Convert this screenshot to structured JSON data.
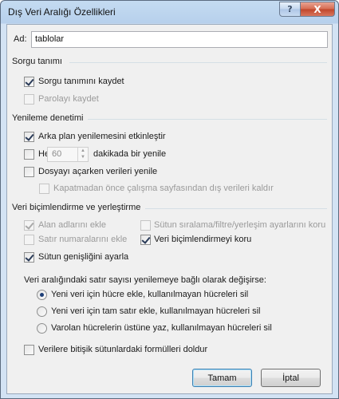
{
  "window": {
    "title": "Dış Veri Aralığı Özellikleri",
    "help_glyph": "?",
    "close_glyph": "X"
  },
  "name": {
    "label": "Ad:",
    "value": "tablolar"
  },
  "query": {
    "group_title": "Sorgu tanımı",
    "save_query": {
      "label": "Sorgu tanımını kaydet",
      "checked": true
    },
    "save_password": {
      "label": "Parolayı kaydet",
      "checked": false,
      "enabled": false
    }
  },
  "refresh": {
    "group_title": "Yenileme denetimi",
    "background_refresh": {
      "label": "Arka plan yenilemesini etkinleştir",
      "checked": true
    },
    "every": {
      "label": "Her",
      "value": "60",
      "suffix": "dakikada bir yenile",
      "checked": false
    },
    "on_open": {
      "label": "Dosyayı açarken verileri yenile",
      "checked": false
    },
    "remove_before_close": {
      "label": "Kapatmadan önce çalışma sayfasından dış verileri kaldır",
      "checked": false,
      "enabled": false
    }
  },
  "formatting": {
    "group_title": "Veri biçimlendirme ve yerleştirme",
    "field_names": {
      "label": "Alan adlarını ekle",
      "checked": true,
      "enabled": false
    },
    "column_sort": {
      "label": "Sütun sıralama/filtre/yerleşim ayarlarını koru",
      "checked": false,
      "enabled": false
    },
    "row_numbers": {
      "label": "Satır numaralarını ekle",
      "checked": false,
      "enabled": false
    },
    "preserve_format": {
      "label": "Veri biçimlendirmeyi koru",
      "checked": true
    },
    "adjust_width": {
      "label": "Sütun genişliğini ayarla",
      "checked": true
    }
  },
  "rows_change": {
    "prompt": "Veri aralığındaki satır sayısı yenilemeye bağlı olarak değişirse:",
    "options": [
      {
        "label": "Yeni veri için hücre ekle, kullanılmayan hücreleri sil",
        "selected": true
      },
      {
        "label": "Yeni veri için tam satır ekle, kullanılmayan hücreleri sil",
        "selected": false
      },
      {
        "label": "Varolan hücrelerin üstüne yaz, kullanılmayan hücreleri sil",
        "selected": false
      }
    ]
  },
  "fill_formulas": {
    "label": "Verilere bitişik sütunlardaki formülleri doldur",
    "checked": false
  },
  "buttons": {
    "ok": "Tamam",
    "cancel": "İptal"
  }
}
